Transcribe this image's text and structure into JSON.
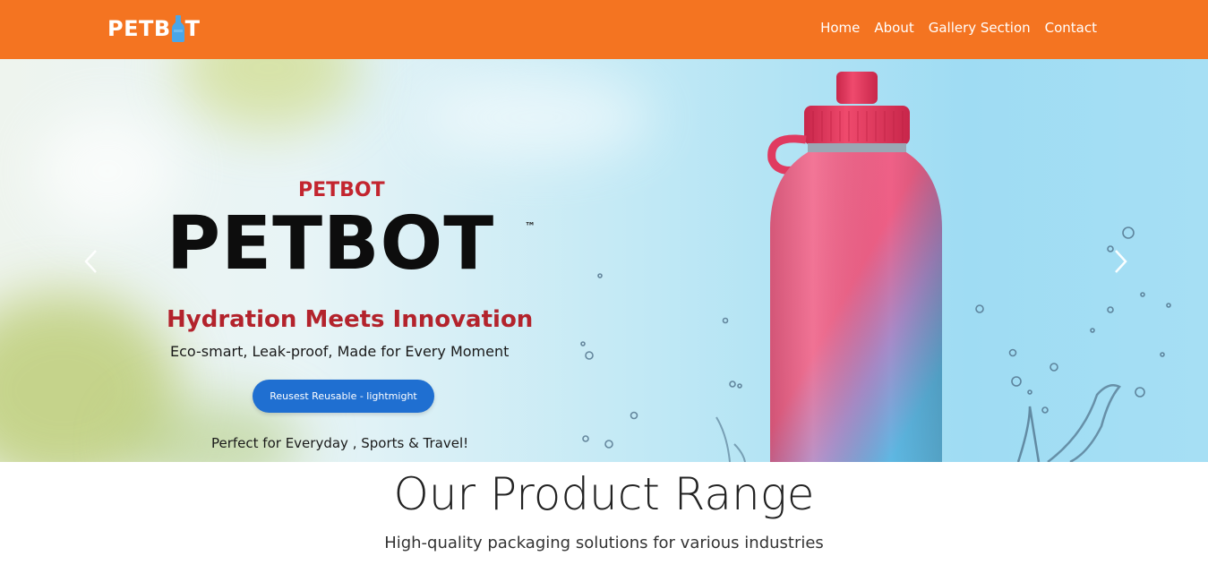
{
  "navbar": {
    "brand_text_left": "PETB",
    "brand_text_right": "T",
    "links": [
      "Home",
      "About",
      "Gallery Section",
      "Contact"
    ],
    "colors": {
      "background": "#f47421",
      "text": "#ffffff"
    }
  },
  "hero": {
    "small_brand": "PETBOT",
    "big_brand": "PETBOT",
    "trademark": "™",
    "tagline": "Hydration Meets Innovation",
    "subline": "Eco-smart, Leak-proof,  Made for Every Moment",
    "cta_label": "Reusest Reusable - lightmight",
    "footer_line": "Perfect for Everyday , Sports & Travel!",
    "prev_icon": "chevron-left-icon",
    "next_icon": "chevron-right-icon",
    "colors": {
      "accent_red": "#c3252f",
      "cta_blue": "#1f6fd1",
      "bottle_pink": "#f05a82",
      "bottle_blue": "#5fb6e0"
    }
  },
  "products": {
    "title": "Our Product Range",
    "subtitle": "High-quality packaging solutions for various industries"
  }
}
